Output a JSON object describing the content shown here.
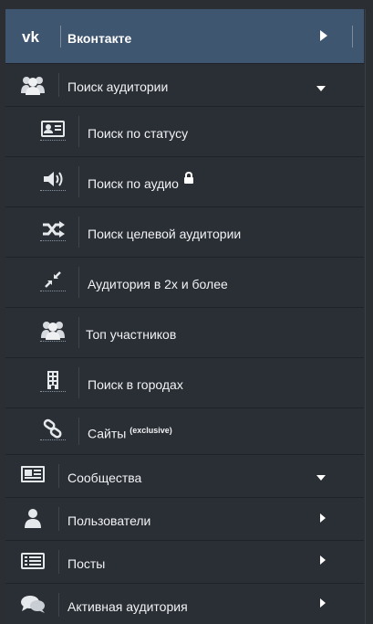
{
  "header": {
    "logo_icon": "vk-logo-icon",
    "title": "Вконтакте",
    "accent_color": "#3f5671"
  },
  "sections": [
    {
      "label": "Поиск аудитории",
      "icon": "users-group-icon",
      "state": "expanded",
      "items": [
        {
          "label": "Поиск по статусу",
          "icon": "id-card-icon"
        },
        {
          "label": "Поиск по аудио",
          "icon": "speaker-icon",
          "badge_icon": "lock-icon"
        },
        {
          "label": "Поиск целевой аудитории",
          "icon": "shuffle-icon"
        },
        {
          "label": "Аудитория в 2х и более",
          "icon": "compress-arrows-icon"
        },
        {
          "label": "Топ участников",
          "icon": "users-group-icon"
        },
        {
          "label": "Поиск в городах",
          "icon": "building-icon"
        },
        {
          "label": "Сайты",
          "icon": "link-icon",
          "superscript": "(exclusive)"
        }
      ]
    },
    {
      "label": "Сообщества",
      "icon": "newspaper-icon",
      "state": "expanded"
    },
    {
      "label": "Пользователи",
      "icon": "user-icon",
      "state": "collapsed"
    },
    {
      "label": "Посты",
      "icon": "list-card-icon",
      "state": "collapsed"
    },
    {
      "label": "Активная аудитория",
      "icon": "chat-bubbles-icon",
      "state": "collapsed"
    }
  ]
}
